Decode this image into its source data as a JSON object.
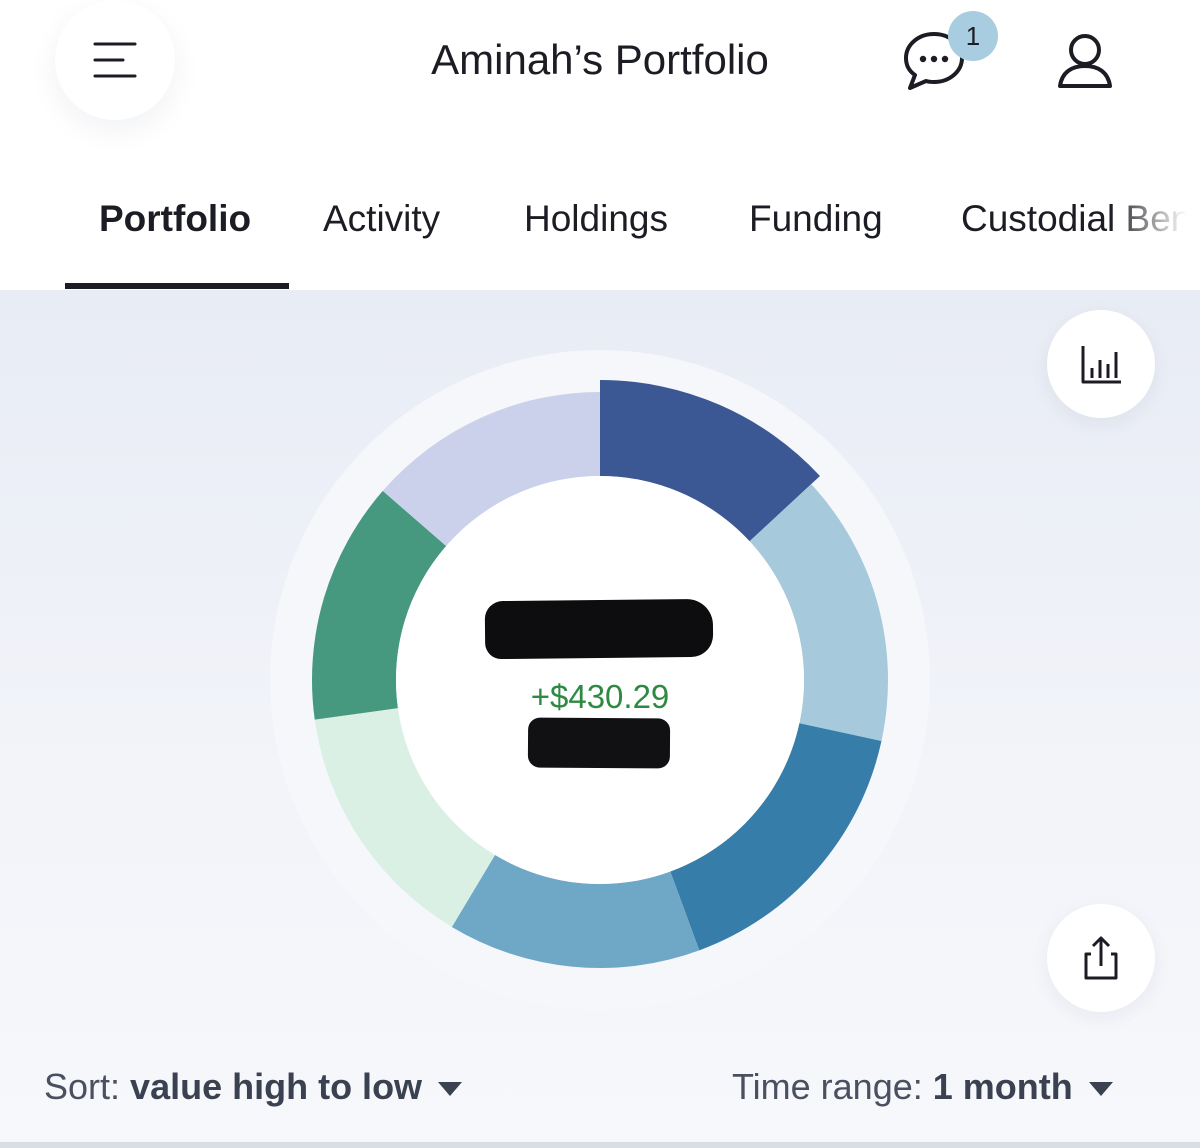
{
  "header": {
    "title": "Aminah’s Portfolio",
    "menu_icon": "hamburger-menu-icon",
    "chat_icon": "chat-bubble-icon",
    "chat_badge_count": "1",
    "profile_icon": "user-profile-icon"
  },
  "tabs": [
    {
      "label": "Portfolio",
      "active": true
    },
    {
      "label": "Activity",
      "active": false
    },
    {
      "label": "Holdings",
      "active": false
    },
    {
      "label": "Funding",
      "active": false
    },
    {
      "label": "Custodial Ben",
      "active": false
    }
  ],
  "actions": {
    "chart_icon": "bar-chart-icon",
    "share_icon": "share-icon"
  },
  "summary": {
    "gain": "+$430.29"
  },
  "allocation": {
    "segment_colors": [
      "#3c5894",
      "#a6c9dc",
      "#377da9",
      "#6fa8c6",
      "#dbf0e4",
      "#46987f",
      "#cbd1ea"
    ],
    "segment_fractions": [
      0.131,
      0.153,
      0.16,
      0.142,
      0.142,
      0.136,
      0.136
    ]
  },
  "controls": {
    "sort_label": "Sort:",
    "sort_value": "value high to low",
    "range_label": "Time range:",
    "range_value": "1 month"
  }
}
